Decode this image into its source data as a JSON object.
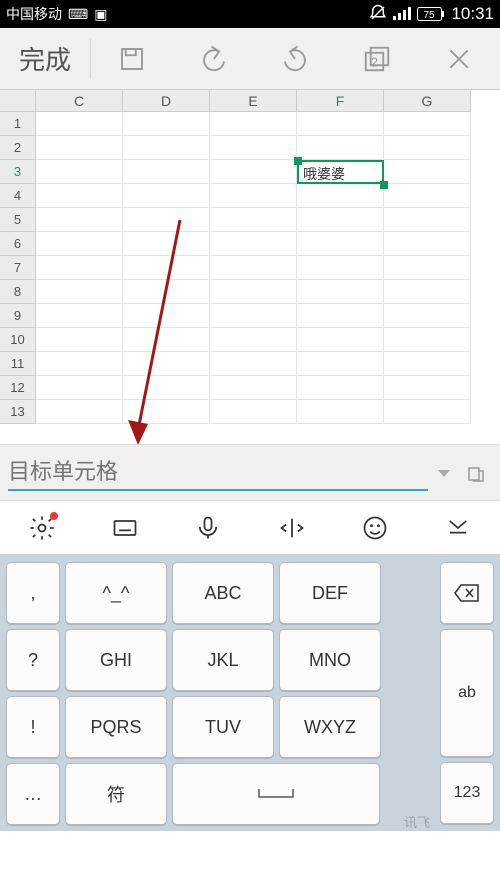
{
  "status": {
    "carrier": "中国移动",
    "battery": "75",
    "time": "10:31"
  },
  "toolbar": {
    "done": "完成",
    "tab_count": "2"
  },
  "sheet": {
    "columns": [
      "C",
      "D",
      "E",
      "F",
      "G"
    ],
    "rows": [
      "1",
      "2",
      "3",
      "4",
      "5",
      "6",
      "7",
      "8",
      "9",
      "10",
      "11",
      "12",
      "13"
    ],
    "selected_col": "F",
    "selected_row": "3",
    "selected_cell_value": "哦婆婆"
  },
  "formula_bar": {
    "placeholder": "目标单元格"
  },
  "keyboard": {
    "left": [
      ",",
      "?",
      "!",
      "…"
    ],
    "rows": [
      [
        "^_^",
        "ABC",
        "DEF"
      ],
      [
        "GHI",
        "JKL",
        "MNO"
      ],
      [
        "PQRS",
        "TUV",
        "WXYZ"
      ]
    ],
    "right": [
      "ab",
      "123"
    ],
    "fu": "符",
    "ime": "讯飞"
  }
}
